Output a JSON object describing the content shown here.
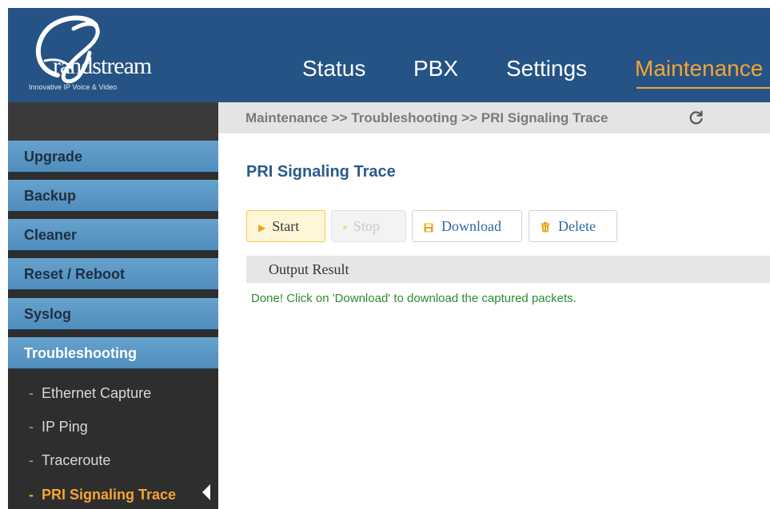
{
  "logo": {
    "wordmark": "randstream",
    "tagline": "Innovative IP Voice & Video"
  },
  "nav": {
    "items": [
      {
        "label": "Status",
        "active": false
      },
      {
        "label": "PBX",
        "active": false
      },
      {
        "label": "Settings",
        "active": false
      },
      {
        "label": "Maintenance",
        "active": true
      }
    ]
  },
  "breadcrumb": "Maintenance >> Troubleshooting >> PRI Signaling Trace",
  "sidebar": {
    "items": [
      {
        "label": "Upgrade"
      },
      {
        "label": "Backup"
      },
      {
        "label": "Cleaner"
      },
      {
        "label": "Reset / Reboot"
      },
      {
        "label": "Syslog"
      },
      {
        "label": "Troubleshooting",
        "active": true
      }
    ],
    "subitems": [
      {
        "label": "Ethernet Capture"
      },
      {
        "label": "IP Ping"
      },
      {
        "label": "Traceroute"
      },
      {
        "label": "PRI Signaling Trace",
        "active": true
      }
    ],
    "dash": "-"
  },
  "main": {
    "title": "PRI Signaling Trace",
    "buttons": {
      "start": "Start",
      "stop": "Stop",
      "download": "Download",
      "delete": "Delete"
    },
    "output_header": "Output Result",
    "output_text": "Done! Click on 'Download' to download the captured packets."
  },
  "colors": {
    "header_bg": "#255385",
    "accent": "#f5a533",
    "sidebar_item": "#5a98c6",
    "success_text": "#2f8a2f"
  },
  "icons": {
    "refresh": "refresh-icon",
    "start": "play-icon",
    "stop": "stop-icon",
    "download": "floppy-icon",
    "delete": "trash-icon"
  }
}
